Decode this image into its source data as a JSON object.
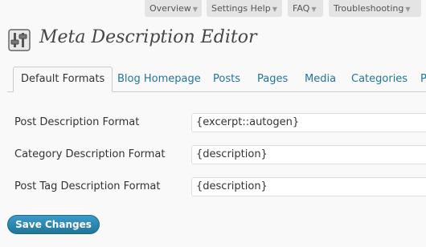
{
  "help_tabs": [
    {
      "label": "Overview"
    },
    {
      "label": "Settings Help"
    },
    {
      "label": "FAQ"
    },
    {
      "label": "Troubleshooting"
    }
  ],
  "page_title": "Meta Description Editor",
  "tabs": [
    {
      "label": "Default Formats",
      "active": true
    },
    {
      "label": "Blog Homepage"
    },
    {
      "label": "Posts"
    },
    {
      "label": "Pages"
    },
    {
      "label": "Media"
    },
    {
      "label": "Categories"
    },
    {
      "label": "P"
    }
  ],
  "form": {
    "rows": [
      {
        "label": "Post Description Format",
        "value": "{excerpt::autogen}"
      },
      {
        "label": "Category Description Format",
        "value": "{description}"
      },
      {
        "label": "Post Tag Description Format",
        "value": "{description}"
      }
    ]
  },
  "save_button": "Save Changes",
  "colors": {
    "link": "#21759b",
    "button": "#21759b",
    "background": "#f9f9f9"
  },
  "icons": [
    "settings-sliders-icon",
    "dropdown-arrow-icon"
  ]
}
